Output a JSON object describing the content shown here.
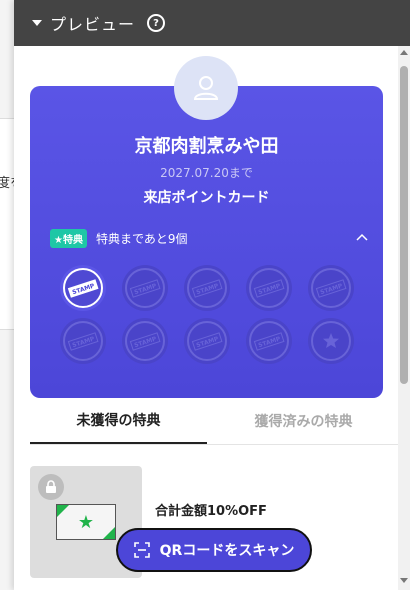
{
  "background": {
    "fragment_text": "度を"
  },
  "header": {
    "title": "プレビュー",
    "help_symbol": "?"
  },
  "card": {
    "shop_name": "京都肉割烹みや田",
    "expiry": "2027.07.20まで",
    "card_type": "来店ポイントカード",
    "perk_badge": "★特典",
    "perk_text": "特典まであと9個",
    "stamps_total": 10,
    "stamps_collected": 1,
    "stamp_label": "STAMP",
    "colors": {
      "card": "#4c46d8",
      "badge": "#1ec7a6"
    }
  },
  "tabs": [
    {
      "label": "未獲得の特典",
      "active": true
    },
    {
      "label": "獲得済みの特典",
      "active": false
    }
  ],
  "benefit": {
    "title": "合計金額10%OFF",
    "subtitle": "・・・",
    "link": "・・・・"
  },
  "qr_button": {
    "label": "QRコードをスキャン"
  }
}
